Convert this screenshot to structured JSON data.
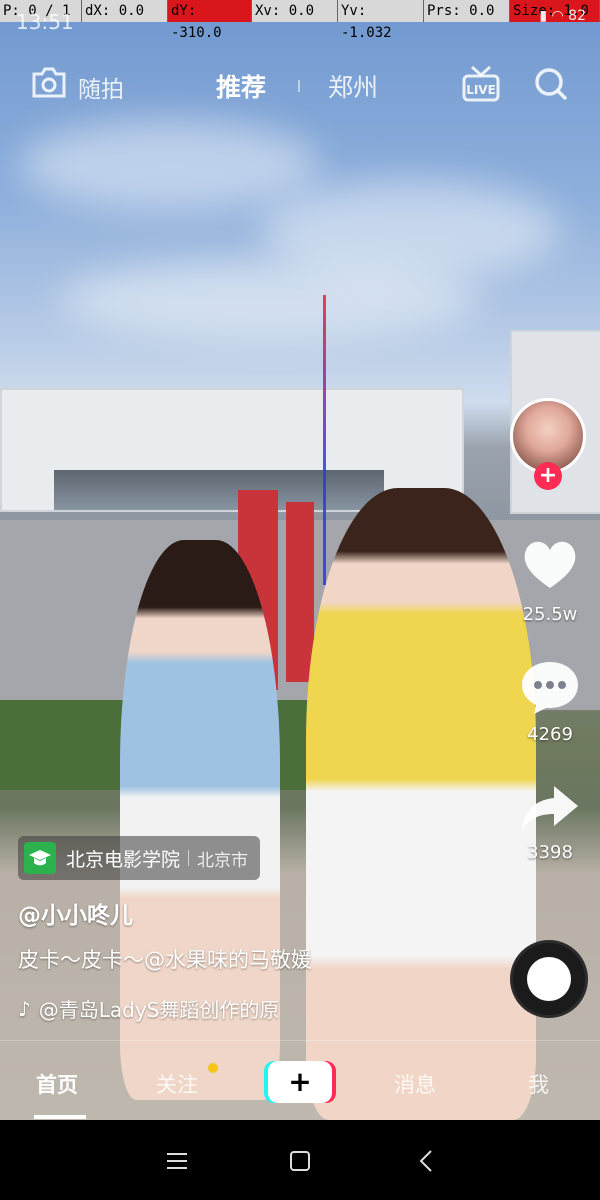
{
  "debug": {
    "p": "P: 0 / 1",
    "dx": "dX: 0.0",
    "dy": "dY: -310.0",
    "xv": "Xv: 0.0",
    "yv": "Yv: -1.032",
    "prs": "Prs: 0.0",
    "size": "Size: 1.0"
  },
  "status": {
    "time": "13:51",
    "battery": "82"
  },
  "topnav": {
    "camera_label": "随拍",
    "tab_recommend": "推荐",
    "tab_city": "郑州",
    "live_icon": "live-icon",
    "search_icon": "search-icon"
  },
  "rail": {
    "likes": "25.5w",
    "comments": "4269",
    "shares": "3398",
    "follow_plus": "+"
  },
  "caption": {
    "location_name": "北京电影学院",
    "location_city": "北京市",
    "author": "@小小咚儿",
    "description": "皮卡～皮卡～@水果味的马敬媛",
    "music": "@青岛LadyS舞蹈创作的原"
  },
  "tabbar": {
    "home": "首页",
    "follow": "关注",
    "plus": "+",
    "messages": "消息",
    "me": "我"
  },
  "colors": {
    "accent_red": "#fe2c55",
    "accent_cyan": "#25f4ee",
    "location_green": "#2bb24c",
    "notify_dot": "#f5c518"
  }
}
